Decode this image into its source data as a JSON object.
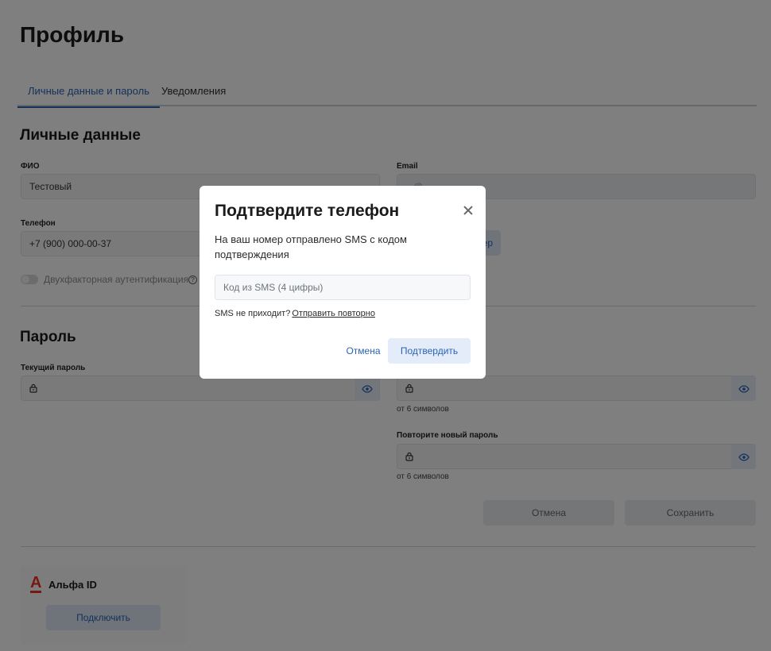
{
  "page": {
    "title": "Профиль",
    "tabs": [
      {
        "label": "Личные данные и пароль",
        "active": true
      },
      {
        "label": "Уведомления",
        "active": false
      }
    ]
  },
  "personal": {
    "title": "Личные данные",
    "fio_label": "ФИО",
    "fio_value": "Тестовый",
    "email_label": "Email",
    "email_value": "...@...",
    "phone_label": "Телефон",
    "phone_value": "+7 (900) 000-00-37",
    "phone_button_fragment": "ер",
    "two_factor_label": "Двухфакторная аутентификация",
    "help_glyph": "?"
  },
  "password": {
    "title": "Пароль",
    "current_label": "Текущий пароль",
    "new_hint": "от 6 символов",
    "repeat_label": "Повторите новый пароль",
    "repeat_hint": "от 6 символов",
    "cancel_label": "Отмена",
    "save_label": "Сохранить"
  },
  "alfa": {
    "logo_letter": "А",
    "title": "Альфа ID",
    "connect_label": "Подключить"
  },
  "modal": {
    "title": "Подтвердите телефон",
    "text": "На ваш номер отправлено SMS с кодом подтверждения",
    "code_placeholder": "Код из SMS (4 цифры)",
    "sms_question": "SMS не приходит?",
    "resend_label": "Отправить повторно",
    "cancel_label": "Отмена",
    "confirm_label": "Подтвердить"
  },
  "colors": {
    "accent": "#2a63b5",
    "overlay": "rgba(0,0,0,0.5)",
    "alfa_red": "#ef3124"
  }
}
